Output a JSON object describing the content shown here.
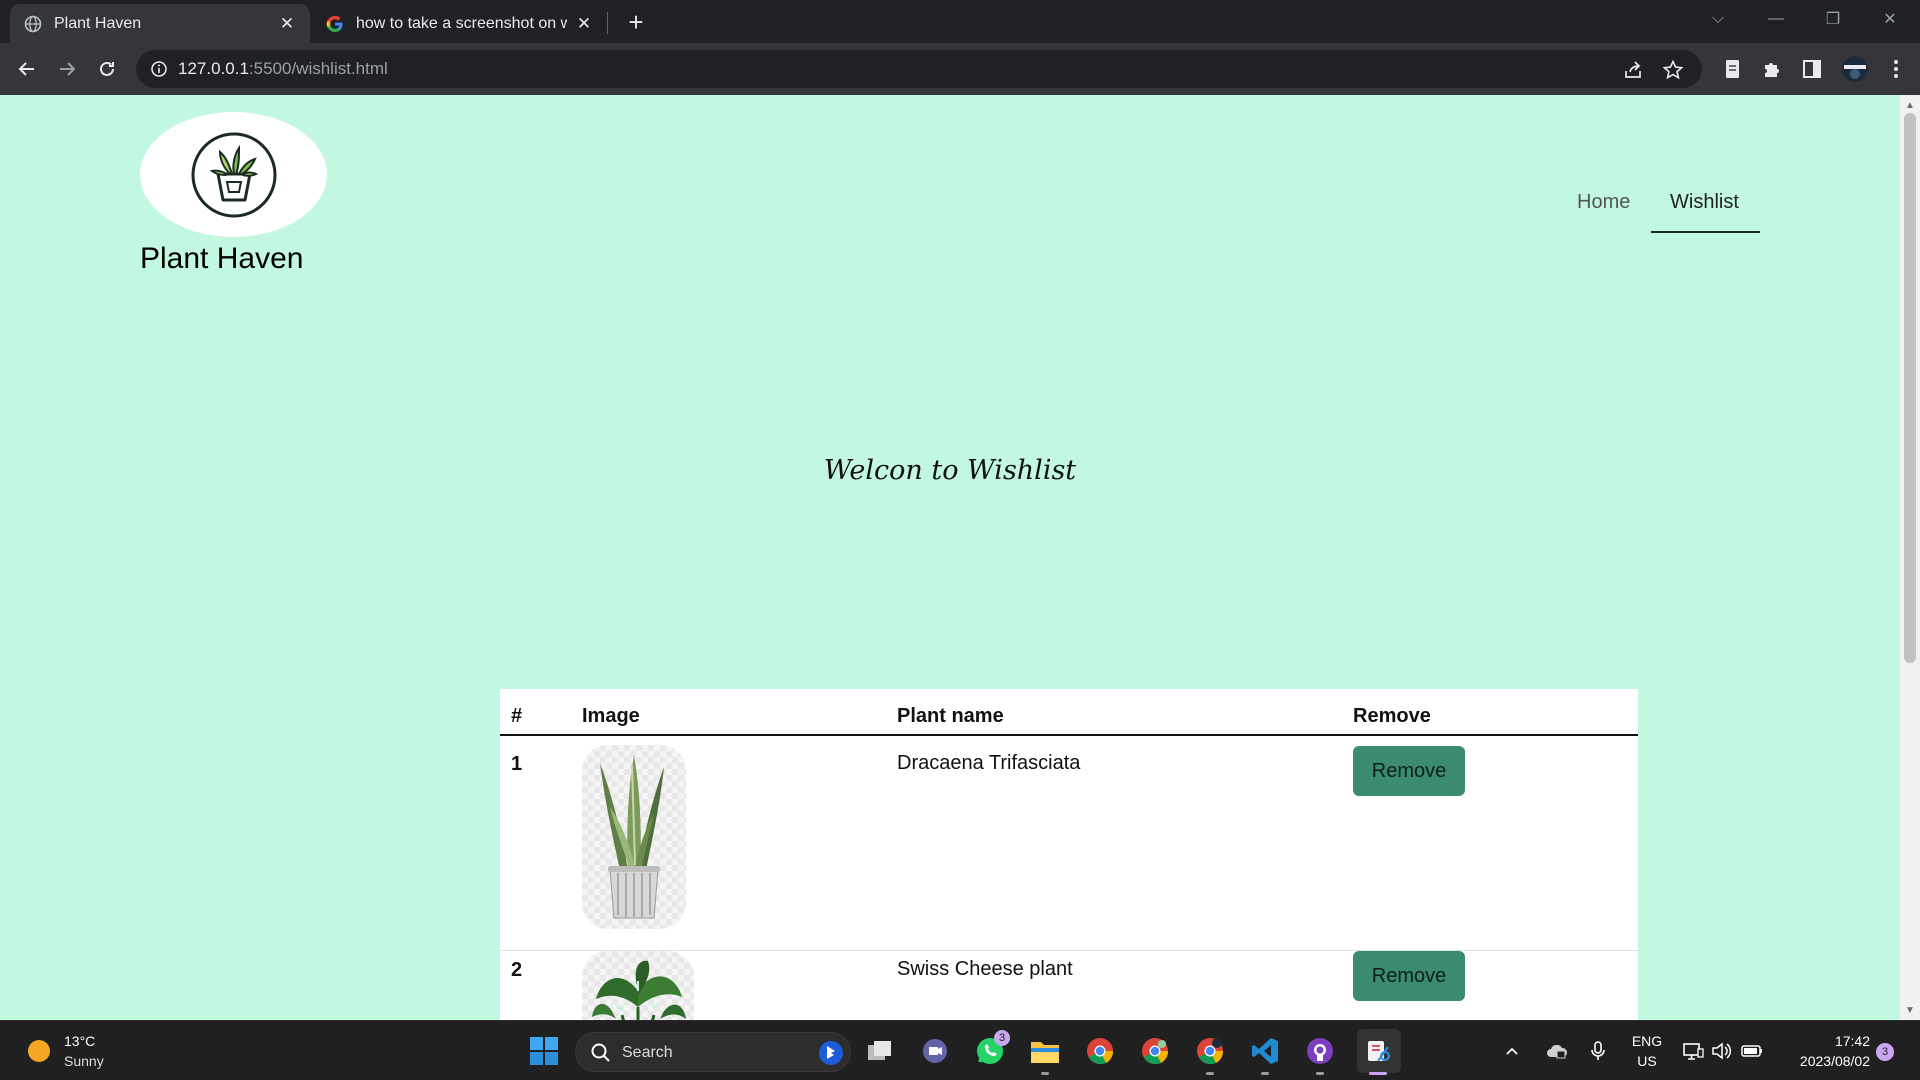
{
  "browser": {
    "tabs": [
      {
        "title": "Plant Haven",
        "active": true
      },
      {
        "title": "how to take a screenshot on wind",
        "active": false
      }
    ],
    "url_host": "127.0.0.1",
    "url_path": ":5500/wishlist.html"
  },
  "site": {
    "brand": "Plant Haven",
    "nav": [
      {
        "label": "Home",
        "active": false
      },
      {
        "label": "Wishlist",
        "active": true
      }
    ],
    "welcome": "Welcon to Wishlist"
  },
  "table": {
    "headers": [
      "#",
      "Image",
      "Plant name",
      "Remove"
    ],
    "rows": [
      {
        "num": "1",
        "name": "Dracaena Trifasciata",
        "button": "Remove"
      },
      {
        "num": "2",
        "name": "Swiss Cheese plant",
        "button": "Remove"
      }
    ]
  },
  "taskbar": {
    "weather_temp": "13°C",
    "weather_cond": "Sunny",
    "search_label": "Search",
    "whatsapp_badge": "3",
    "lang_top": "ENG",
    "lang_bottom": "US",
    "time": "17:42",
    "date": "2023/08/02",
    "notification_badge": "3"
  },
  "colors": {
    "page_bg": "#c2f8e0",
    "button_bg": "#3b8c6e",
    "chrome_dark": "#202124",
    "chrome_toolbar": "#35363a"
  }
}
